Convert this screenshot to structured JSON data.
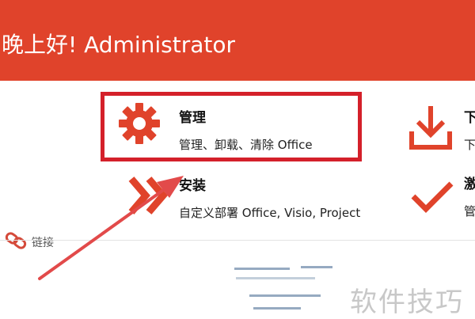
{
  "header": {
    "greeting": "晚上好!",
    "user": "Administrator"
  },
  "options": {
    "manage": {
      "title": "管理",
      "desc": "管理、卸载、清除 Office",
      "icon": "gear-icon"
    },
    "install": {
      "title": "安装",
      "desc": "自定义部署 Office, Visio, Project",
      "icon": "double-chevron-right-icon"
    },
    "download": {
      "title_partial": "下",
      "desc_partial": "下",
      "icon": "download-icon"
    },
    "activate": {
      "title_partial": "激",
      "desc_partial": "管",
      "icon": "checkmark-icon"
    }
  },
  "links": {
    "label": "链接",
    "icon": "link-icon"
  },
  "watermark": "软件技巧",
  "colors": {
    "accent": "#e0432b",
    "highlight": "#d4202a",
    "arrow": "#e24a4a"
  }
}
